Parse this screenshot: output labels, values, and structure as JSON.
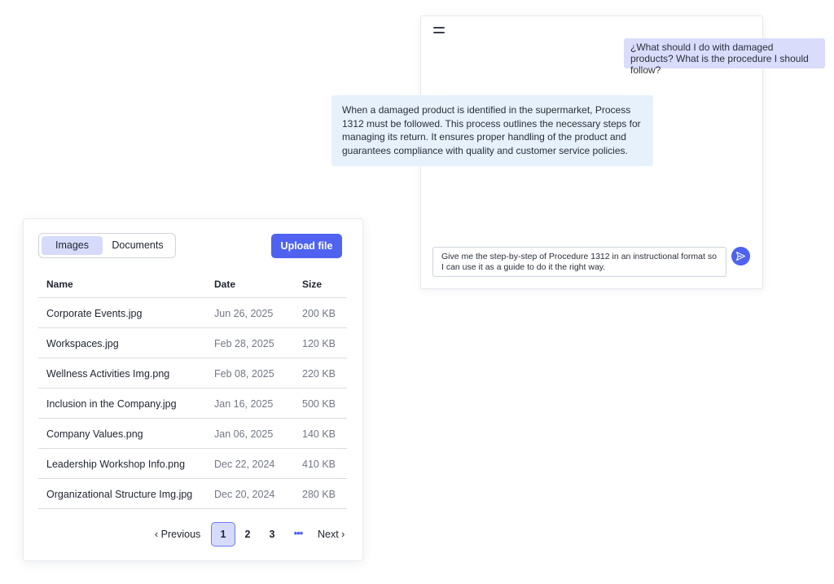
{
  "chat": {
    "user_message": "¿What should I do with damaged products? What is the procedure I should follow?",
    "bot_message": "When a damaged product is identified in the supermarket, Process 1312 must be followed. This process outlines the necessary steps for managing its return. It ensures proper handling of the product and guarantees compliance with quality and customer service policies.",
    "input_value": "Give me the step-by-step of Procedure 1312 in an instructional format so I can use it as a guide to do it the right way.",
    "accent_color": "#4f63f0"
  },
  "files": {
    "tabs": [
      {
        "label": "Images",
        "active": true
      },
      {
        "label": "Documents",
        "active": false
      }
    ],
    "upload_label": "Upload file",
    "columns": {
      "name": "Name",
      "date": "Date",
      "size": "Size"
    },
    "rows": [
      {
        "name": "Corporate Events.jpg",
        "date": "Jun 26, 2025",
        "size": "200 KB"
      },
      {
        "name": "Workspaces.jpg",
        "date": "Feb 28, 2025",
        "size": "120 KB"
      },
      {
        "name": "Wellness Activities Img.png",
        "date": "Feb 08, 2025",
        "size": "220 KB"
      },
      {
        "name": "Inclusion in the Company.jpg",
        "date": "Jan 16, 2025",
        "size": "500 KB"
      },
      {
        "name": "Company Values.png",
        "date": "Jan 06, 2025",
        "size": "140 KB"
      },
      {
        "name": "Leadership Workshop Info.png",
        "date": "Dec 22, 2024",
        "size": "410 KB"
      },
      {
        "name": "Organizational Structure Img.jpg",
        "date": "Dec 20, 2024",
        "size": "280 KB"
      }
    ],
    "pagination": {
      "previous": "Previous",
      "pages": [
        "1",
        "2",
        "3"
      ],
      "current": "1",
      "ellipsis": "•••",
      "next": "Next"
    }
  }
}
